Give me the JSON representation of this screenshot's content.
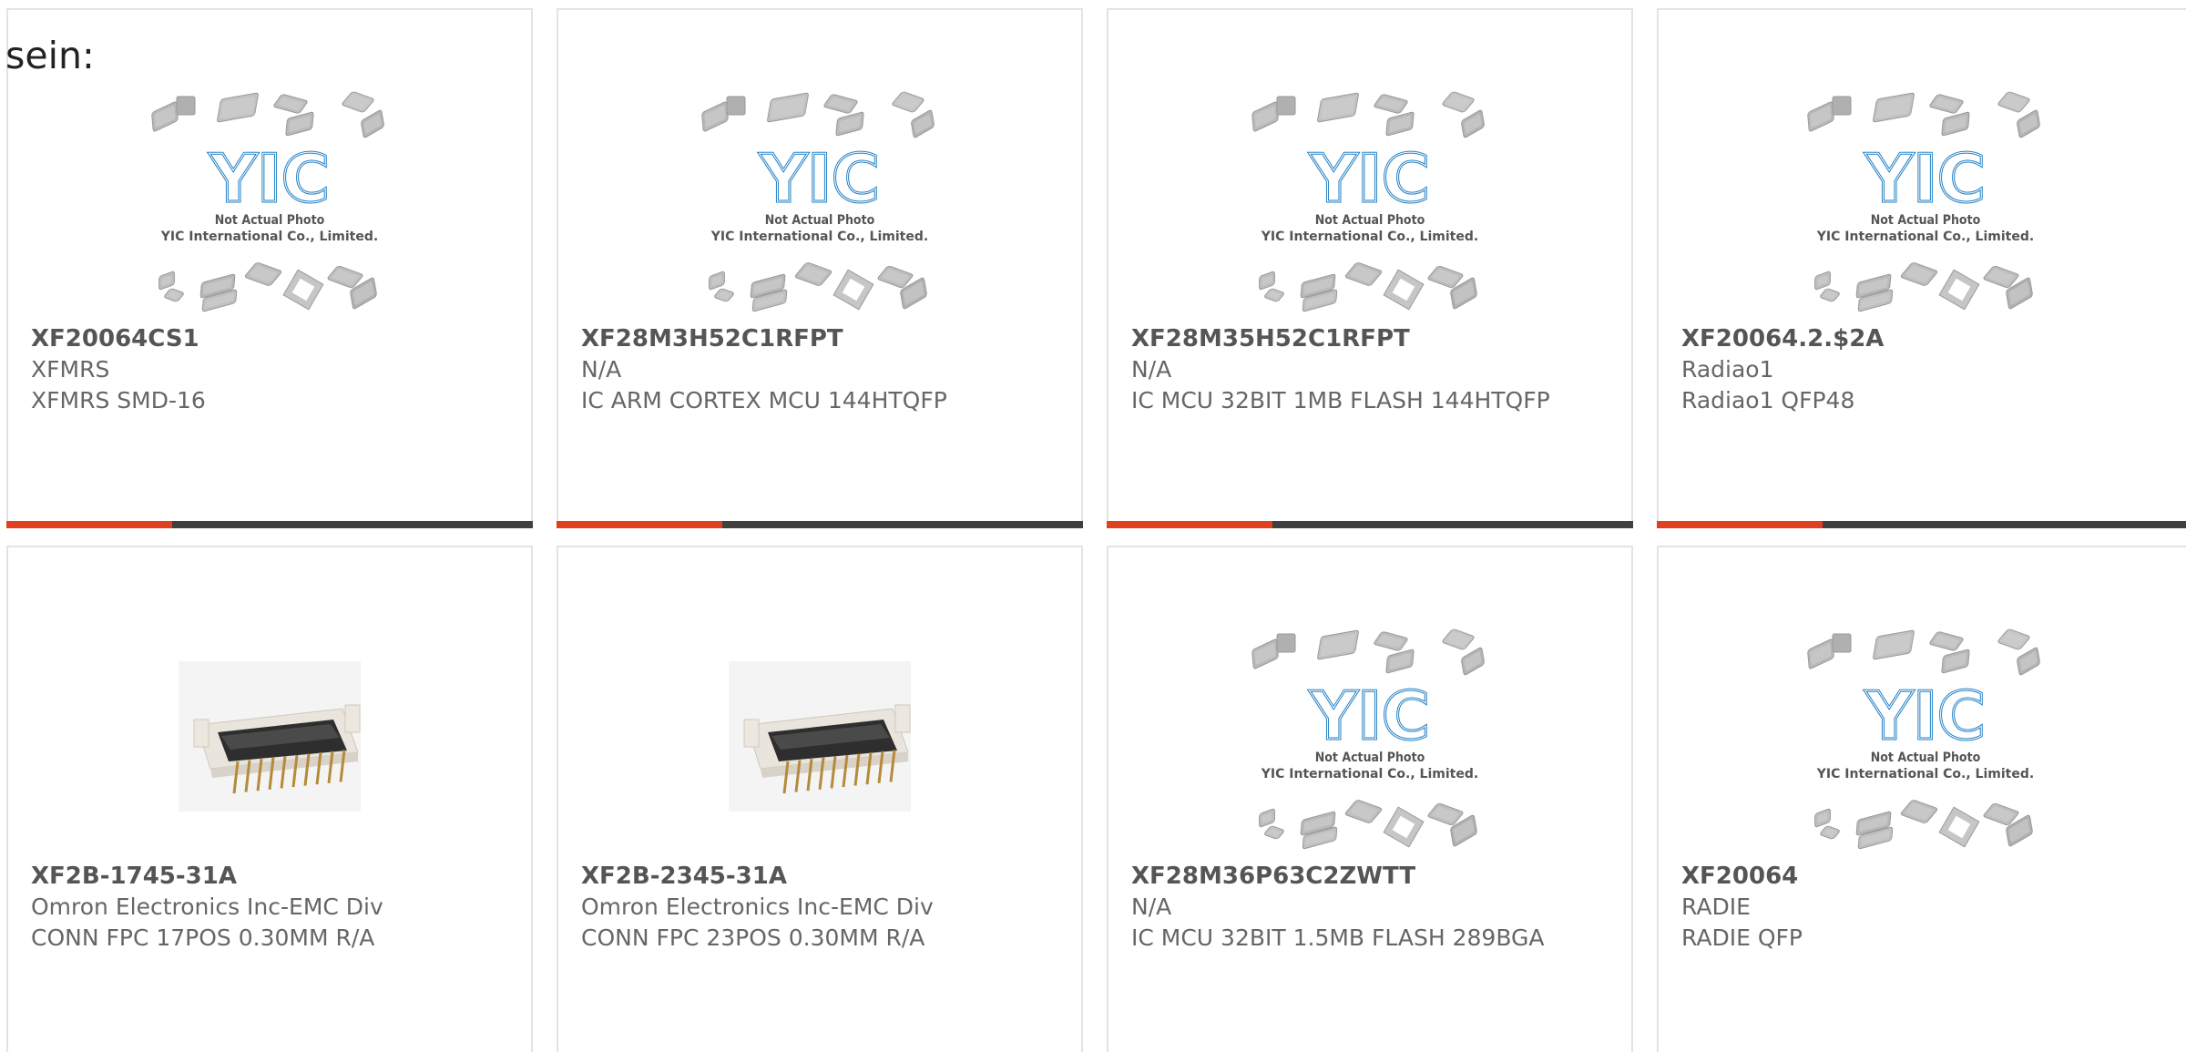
{
  "page": {
    "lead_text": "sein:"
  },
  "theme": {
    "accent": "#e0401f",
    "bar_dark": "#404040",
    "card_border": "#e3e3e3",
    "logo_blue": "#1f7fc4"
  },
  "placeholder": {
    "line1": "Not Actual Photo",
    "line2": "YIC International Co., Limited.",
    "logo_text": "YIC"
  },
  "products": [
    {
      "part_no": "XF20064CS1",
      "maker": "XFMRS",
      "desc": "XFMRS SMD-16",
      "image": "yic-placeholder"
    },
    {
      "part_no": "XF28M3H52C1RFPT",
      "maker": "N/A",
      "desc": "IC ARM CORTEX MCU 144HTQFP",
      "image": "yic-placeholder"
    },
    {
      "part_no": "XF28M35H52C1RFPT",
      "maker": "N/A",
      "desc": "IC MCU 32BIT 1MB FLASH 144HTQFP",
      "image": "yic-placeholder"
    },
    {
      "part_no": "XF20064.2.$2A",
      "maker": "Radiao1",
      "desc": "Radiao1 QFP48",
      "image": "yic-placeholder"
    },
    {
      "part_no": "XF2B-1745-31A",
      "maker": "Omron Electronics Inc-EMC Div",
      "desc": "CONN FPC 17POS 0.30MM R/A",
      "image": "fpc-connector"
    },
    {
      "part_no": "XF2B-2345-31A",
      "maker": "Omron Electronics Inc-EMC Div",
      "desc": "CONN FPC 23POS 0.30MM R/A",
      "image": "fpc-connector"
    },
    {
      "part_no": "XF28M36P63C2ZWTT",
      "maker": "N/A",
      "desc": "IC MCU 32BIT 1.5MB FLASH 289BGA",
      "image": "yic-placeholder"
    },
    {
      "part_no": "XF20064",
      "maker": "RADIE",
      "desc": "RADIE QFP",
      "image": "yic-placeholder"
    }
  ]
}
